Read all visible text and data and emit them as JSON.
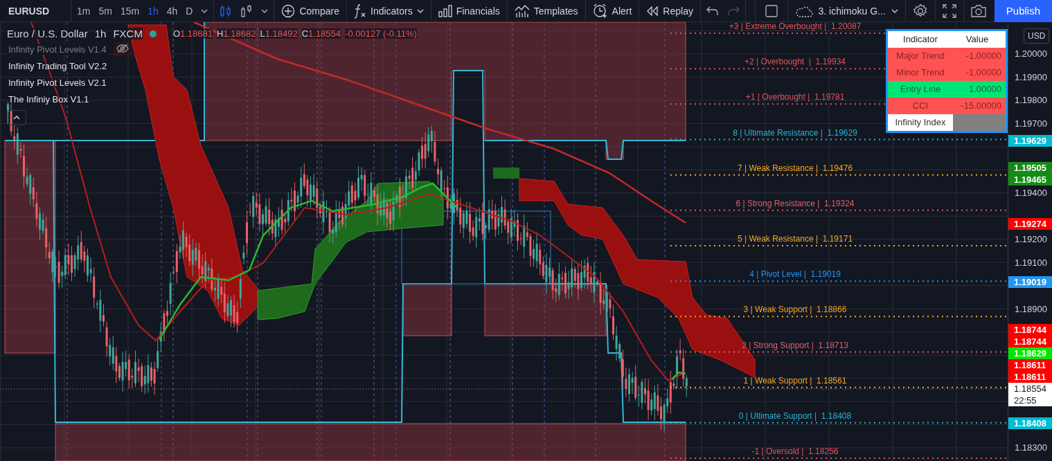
{
  "toolbar": {
    "symbol": "EURUSD",
    "intervals": [
      {
        "label": "1m",
        "selected": false
      },
      {
        "label": "5m",
        "selected": false
      },
      {
        "label": "15m",
        "selected": false
      },
      {
        "label": "1h",
        "selected": true
      },
      {
        "label": "4h",
        "selected": false
      },
      {
        "label": "D",
        "selected": false
      }
    ],
    "chart_types": [
      {
        "kind": "candles",
        "selected": true
      },
      {
        "kind": "bars",
        "selected": false
      }
    ],
    "tools": [
      {
        "kind": "compare",
        "label": "Compare"
      },
      {
        "kind": "indicators",
        "label": "Indicators"
      },
      {
        "kind": "financials",
        "label": "Financials"
      },
      {
        "kind": "templates",
        "label": "Templates"
      },
      {
        "kind": "alert",
        "label": "Alert"
      },
      {
        "kind": "replay",
        "label": "Replay"
      }
    ],
    "history": [
      {
        "kind": "undo",
        "disabled": false
      },
      {
        "kind": "redo",
        "disabled": true
      }
    ],
    "layout": {
      "label": "3. ichimoku G..."
    },
    "actions": [
      {
        "kind": "settings"
      },
      {
        "kind": "fullscreen"
      },
      {
        "kind": "snapshot"
      }
    ],
    "publish": "Publish"
  },
  "legend": {
    "title": "Euro / U.S. Dollar",
    "interval": "1h",
    "source": "FXCM",
    "ohlc": [
      {
        "key": "O",
        "value": "1.18681"
      },
      {
        "key": "H",
        "value": "1.18682"
      },
      {
        "key": "L",
        "value": "1.18492"
      },
      {
        "key": "C",
        "value": "1.18554"
      }
    ],
    "change": "-0.00127 (-0.11%)",
    "indicators": [
      {
        "name": "Infinity Pivot Levels V1.4",
        "visible": false
      },
      {
        "name": "Infinity Trading Tool V2.2",
        "visible": true
      },
      {
        "name": "Infinity Pivot Levels V2.1",
        "visible": true
      },
      {
        "name": "The Infiniy Box V1.1",
        "visible": true
      }
    ]
  },
  "levels": [
    {
      "label": "+3 | Extreme Overbought |  1.20087",
      "color": "#e0545a"
    },
    {
      "label": "+2 | Overbought  |  1.19934",
      "color": "#e0545a"
    },
    {
      "label": "+1 | Overbought |  1.19781",
      "color": "#e0545a"
    },
    {
      "label": "8 | Ultimate Resistance |  1.19629",
      "color": "#26b5d0"
    },
    {
      "label": "7 | Weak Resistance |  1.19476",
      "color": "#f5a623"
    },
    {
      "label": "6 | Strong Resistance |  1.19324",
      "color": "#e0606a"
    },
    {
      "label": "5 | Weak Resistance |  1.19171",
      "color": "#f5a623"
    },
    {
      "label": "4 | Pivot Level |  1.19019",
      "color": "#2196f3"
    },
    {
      "label": "3 | Weak Support |  1.18866",
      "color": "#f5a623"
    },
    {
      "label": "2 | Strong Support |  1.18713",
      "color": "#e0606a"
    },
    {
      "label": "1 | Weak Support |  1.18561",
      "color": "#f5a623"
    },
    {
      "label": "0 | Ultimate Support |  1.18408",
      "color": "#26b5d0"
    },
    {
      "label": "-1 | Oversold |  1.18256",
      "color": "#e0545a"
    }
  ],
  "table": {
    "columns": [
      "Indicator",
      "Value"
    ],
    "rows": [
      {
        "indicator": "Major Trend",
        "value": "-1.00000",
        "kind": "value",
        "color": "#ff5252"
      },
      {
        "indicator": "Minor Trend",
        "value": "-1.00000",
        "kind": "value",
        "color": "#ff5252"
      },
      {
        "indicator": "Entry Line",
        "value": "1.00000",
        "kind": "value",
        "color": "#00e676"
      },
      {
        "indicator": "CCI",
        "value": "-15.00000",
        "kind": "value",
        "color": "#ff5252"
      },
      {
        "indicator": "Infinity Index",
        "kind": "index",
        "color": "#808080"
      }
    ]
  },
  "price_axis": {
    "currency": "USD",
    "ticks": [
      "1.20000",
      "1.19900",
      "1.19800",
      "1.19700",
      "1.19400",
      "1.19200",
      "1.19100",
      "1.18900",
      "1.18300"
    ],
    "badges": [
      {
        "label": "1.19629",
        "color": "#00bcd4"
      },
      {
        "label": "1.19505",
        "color": "#168a16"
      },
      {
        "label": "1.19465",
        "color": "#168a16"
      },
      {
        "label": "1.19274",
        "color": "#ff0000"
      },
      {
        "label": "1.19019",
        "color": "#2196f3"
      },
      {
        "label": "1.18744",
        "color": "#ff0000"
      },
      {
        "label": "1.18744",
        "color": "#ff0000"
      },
      {
        "label": "1.18629",
        "color": "#00e600"
      },
      {
        "label": "1.18611",
        "color": "#ff0000"
      },
      {
        "label": "1.18611",
        "color": "#ff0000"
      },
      {
        "label": "1.18554",
        "time": "22:55",
        "color": "#ffffff"
      },
      {
        "label": "1.18408",
        "color": "#00bcd4"
      }
    ]
  }
}
